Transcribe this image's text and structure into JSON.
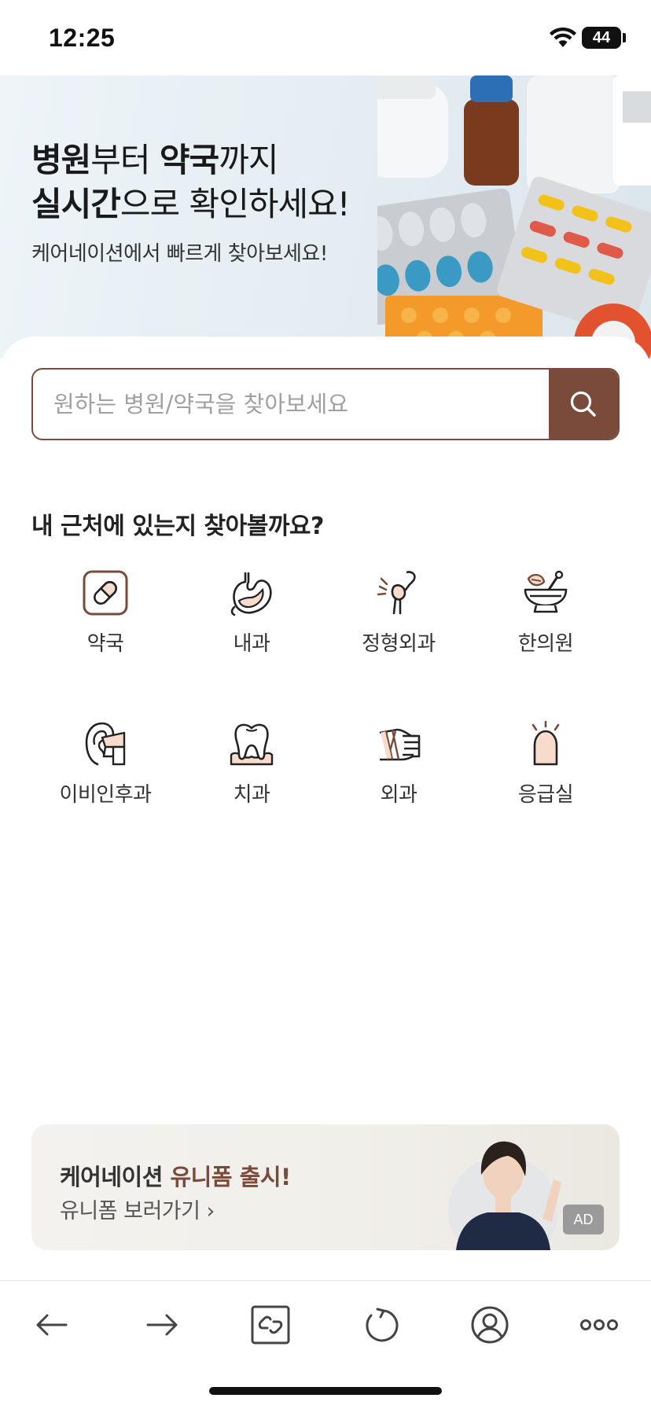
{
  "status_bar": {
    "time": "12:25",
    "battery": "44",
    "icons": [
      "wifi-icon",
      "battery-icon"
    ]
  },
  "hero": {
    "title_line1_bold1": "병원",
    "title_line1_normal1": "부터 ",
    "title_line1_bold2": "약국",
    "title_line1_normal2": "까지",
    "title_line2_bold": "실시간",
    "title_line2_normal": "으로 확인하세요!",
    "subtitle": "케어네이션에서 빠르게 찾아보세요!"
  },
  "search": {
    "placeholder": "원하는 병원/약국을 찾아보세요",
    "value": "",
    "icon": "search-icon"
  },
  "nearby": {
    "title": "내 근처에 있는지 찾아볼까요?",
    "categories": [
      {
        "label": "약국",
        "icon": "pill-icon"
      },
      {
        "label": "내과",
        "icon": "stomach-icon"
      },
      {
        "label": "정형외과",
        "icon": "bone-joint-icon"
      },
      {
        "label": "한의원",
        "icon": "mortar-pestle-icon"
      },
      {
        "label": "이비인후과",
        "icon": "ear-icon"
      },
      {
        "label": "치과",
        "icon": "tooth-icon"
      },
      {
        "label": "외과",
        "icon": "bandaged-hand-icon"
      },
      {
        "label": "응급실",
        "icon": "emergency-light-icon"
      }
    ]
  },
  "ad": {
    "title_prefix": "케어네이션 ",
    "title_highlight": "유니폼 출시!",
    "link": "유니폼 보러가기 ›",
    "badge": "AD"
  },
  "toolbar": {
    "icons": [
      "back-arrow-icon",
      "forward-arrow-icon",
      "link-icon",
      "reload-icon",
      "profile-icon",
      "more-icon"
    ]
  },
  "colors": {
    "accent": "#7a4b3a",
    "icon_fill": "#f7dccd"
  }
}
